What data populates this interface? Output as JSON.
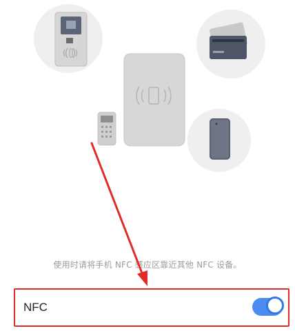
{
  "hint_text": "使用时请将手机 NFC 感应区靠近其他 NFC 设备。",
  "nfc_setting": {
    "label": "NFC",
    "enabled": true
  },
  "colors": {
    "accent": "#2f76ea",
    "annotation": "#e02b2b"
  },
  "illustration": {
    "items": [
      "transit-gate-icon",
      "bank-card-icon",
      "card-reader-icon",
      "pos-terminal-icon",
      "phone-icon"
    ]
  }
}
